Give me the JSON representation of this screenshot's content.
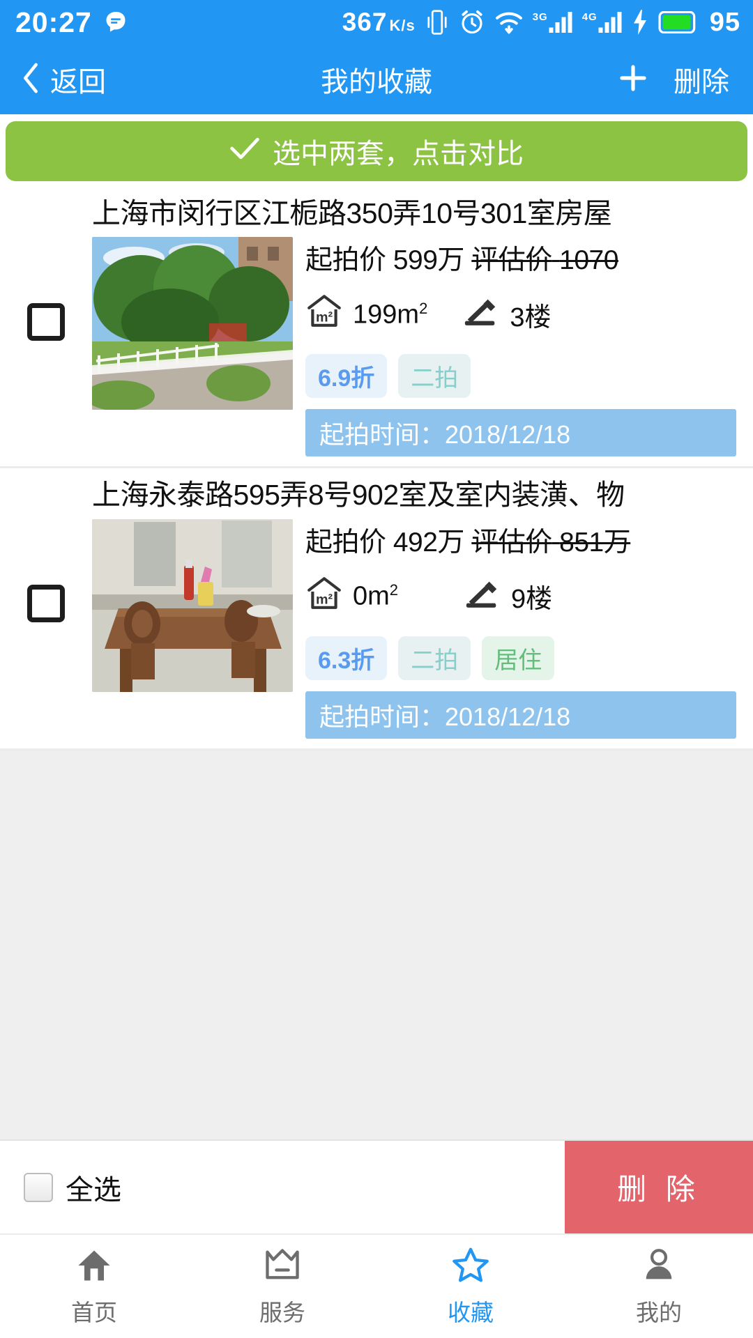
{
  "status_bar": {
    "time": "20:27",
    "message_icon": "message-icon",
    "network_speed": "367",
    "network_speed_unit": "K/s",
    "vibrate_icon": "vibrate-icon",
    "alarm_icon": "alarm-icon",
    "wifi_icon": "wifi-icon",
    "signal1_gen": "3G",
    "signal2_gen": "4G",
    "charging_icon": "charging-bolt-icon",
    "battery_level": "95"
  },
  "nav": {
    "back_label": "返回",
    "title": "我的收藏",
    "add_label": "+",
    "delete_label": "删除"
  },
  "compare_banner": {
    "check_icon": "check-icon",
    "label": "选中两套，点击对比",
    "background_color": "#8cc342"
  },
  "listings": [
    {
      "title": "上海市闵行区江栀路350弄10号301室房屋",
      "start_price_label": "起拍价",
      "start_price": "599万",
      "appraisal_label": "评估价",
      "appraisal_price": "1070",
      "area_icon": "house-area-icon",
      "area": "199m",
      "area_unit_sup": "2",
      "floor_icon": "gavel-icon",
      "floor": "3楼",
      "tags": [
        {
          "text": "6.9折",
          "kind": "discount"
        },
        {
          "text": "二拍",
          "kind": "round"
        }
      ],
      "time_label": "起拍时间：",
      "time_value": "2018/12/18",
      "photo": "outdoor-garden-photo"
    },
    {
      "title": "上海永泰路595弄8号902室及室内装潢、物",
      "start_price_label": "起拍价",
      "start_price": "492万",
      "appraisal_label": "评估价",
      "appraisal_price": "851万",
      "area_icon": "house-area-icon",
      "area": "0m",
      "area_unit_sup": "2",
      "floor_icon": "gavel-icon",
      "floor": "9楼",
      "tags": [
        {
          "text": "6.3折",
          "kind": "discount"
        },
        {
          "text": "二拍",
          "kind": "round"
        },
        {
          "text": "居住",
          "kind": "use"
        }
      ],
      "time_label": "起拍时间：",
      "time_value": "2018/12/18",
      "photo": "dining-table-photo"
    }
  ],
  "action_bar": {
    "select_all_label": "全选",
    "delete_button_label": "删 除",
    "delete_button_color": "#e4646c"
  },
  "tabbar": {
    "items": [
      {
        "label": "首页",
        "icon": "home-icon",
        "active": false
      },
      {
        "label": "服务",
        "icon": "crown-icon",
        "active": false
      },
      {
        "label": "收藏",
        "icon": "star-icon",
        "active": true
      },
      {
        "label": "我的",
        "icon": "person-icon",
        "active": false
      }
    ],
    "active_color": "#2196f3"
  }
}
